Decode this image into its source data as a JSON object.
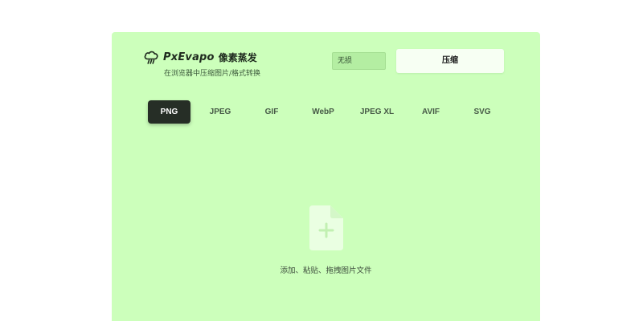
{
  "header": {
    "brand_name": "PxEvapo",
    "brand_name_cn": "像素蒸发",
    "logo_icon": "cloud-rain-icon",
    "tagline": "在浏览器中压缩图片/格式转换"
  },
  "controls": {
    "mode_value": "无损",
    "compress_label": "压缩"
  },
  "format_tabs": [
    {
      "label": "PNG",
      "active": true
    },
    {
      "label": "JPEG",
      "active": false
    },
    {
      "label": "GIF",
      "active": false
    },
    {
      "label": "WebP",
      "active": false
    },
    {
      "label": "JPEG XL",
      "active": false
    },
    {
      "label": "AVIF",
      "active": false
    },
    {
      "label": "SVG",
      "active": false
    }
  ],
  "drop_zone": {
    "icon": "file-add-icon",
    "hint": "添加、粘贴、拖拽图片文件"
  },
  "colors": {
    "panel_background": "#ccffbb",
    "active_tab": "#262e26",
    "compress_button": "#f7fff3",
    "file_icon": "#eaffe2"
  }
}
